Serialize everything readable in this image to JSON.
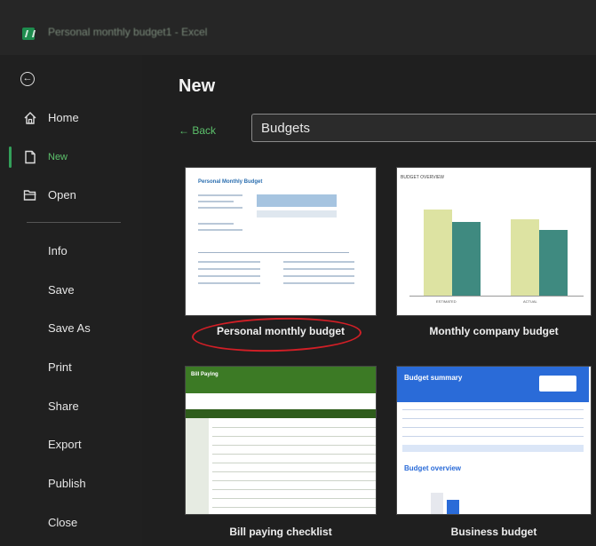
{
  "window": {
    "title": "Personal monthly budget1 - Excel"
  },
  "sidebar": {
    "items": [
      {
        "label": "Home",
        "icon": "home-icon"
      },
      {
        "label": "New",
        "icon": "new-file-icon",
        "active": true
      },
      {
        "label": "Open",
        "icon": "folder-open-icon"
      }
    ],
    "sub_items": [
      "Info",
      "Save",
      "Save As",
      "Print",
      "Share",
      "Export",
      "Publish",
      "Close"
    ]
  },
  "main": {
    "title": "New",
    "back_label": "← Back",
    "search_value": "Budgets"
  },
  "templates": [
    {
      "label": "Personal monthly budget",
      "thumb_title": "Personal Monthly Budget",
      "highlighted": true
    },
    {
      "label": "Monthly company budget",
      "thumb_title": "BUDGET OVERVIEW"
    },
    {
      "label": "Bill paying checklist",
      "thumb_title": "Bill Paying"
    },
    {
      "label": "Business budget",
      "thumb_title": "Budget summary",
      "thumb_subtitle": "Budget overview"
    }
  ],
  "chart_thumb": {
    "categories": [
      "ESTIMATED",
      "ACTUAL"
    ],
    "series": [
      {
        "values": [
          0.84,
          0.75
        ],
        "color": "#dde3a2"
      },
      {
        "values": [
          0.72,
          0.64
        ],
        "color": "#3f8a80"
      }
    ]
  },
  "colors": {
    "accent_green": "#5cc06b",
    "highlight_red": "#d11f26"
  }
}
